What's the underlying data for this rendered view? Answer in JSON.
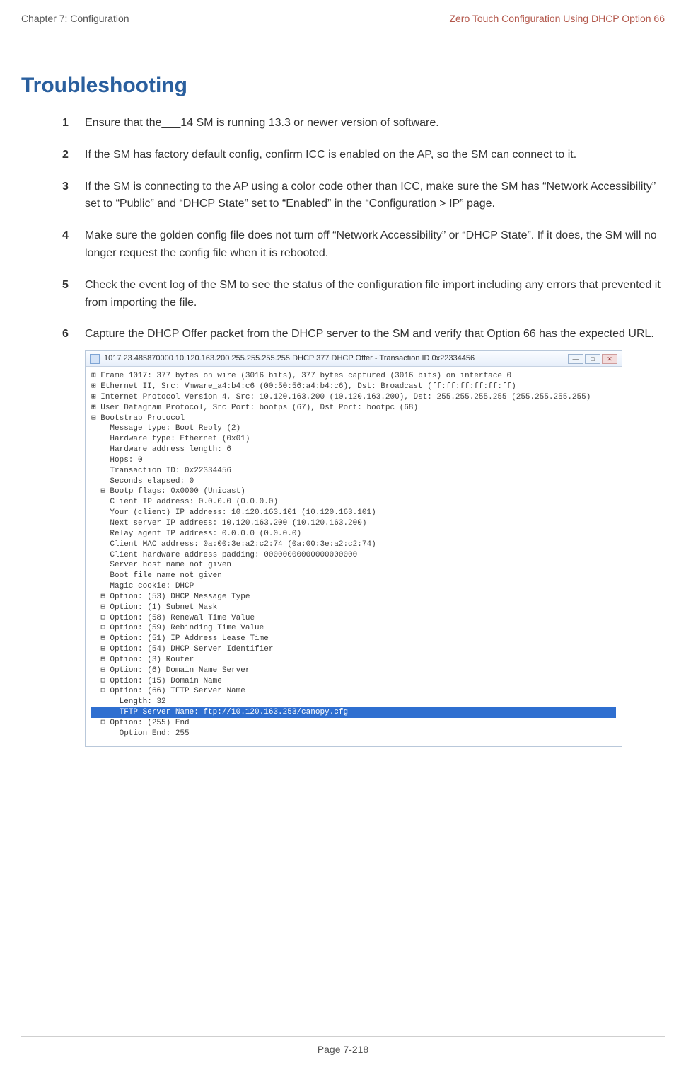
{
  "header": {
    "left": "Chapter 7:  Configuration",
    "right": "Zero Touch Configuration Using DHCP Option 66"
  },
  "title": "Troubleshooting",
  "steps": [
    {
      "n": "1",
      "t": "Ensure that the___14 SM is running 13.3 or newer version of software."
    },
    {
      "n": "2",
      "t": "If the SM has factory default config, confirm ICC is enabled on the AP, so the SM can connect to it."
    },
    {
      "n": "3",
      "t": "If the SM is connecting to the AP using a color code other than ICC, make sure the SM has “Network Accessibility” set to “Public” and “DHCP State” set to “Enabled” in the “Configuration > IP” page."
    },
    {
      "n": "4",
      "t": "Make sure the golden config file does not turn off “Network Accessibility” or “DHCP State”. If it does, the SM will no longer request the config file when it is rebooted."
    },
    {
      "n": "5",
      "t": "Check the event log of the SM to see the status of the configuration file import including any errors that prevented it from importing the file."
    },
    {
      "n": "6",
      "t": "Capture the DHCP Offer packet from the DHCP server to the SM and verify that Option 66 has the expected URL."
    }
  ],
  "figure": {
    "window_title": "1017 23.485870000 10.120.163.200 255.255.255.255 DHCP 377 DHCP Offer   - Transaction ID 0x22334456",
    "win_min": "—",
    "win_max": "□",
    "win_close": "✕",
    "lines": [
      "⊞ Frame 1017: 377 bytes on wire (3016 bits), 377 bytes captured (3016 bits) on interface 0",
      "⊞ Ethernet II, Src: Vmware_a4:b4:c6 (00:50:56:a4:b4:c6), Dst: Broadcast (ff:ff:ff:ff:ff:ff)",
      "⊞ Internet Protocol Version 4, Src: 10.120.163.200 (10.120.163.200), Dst: 255.255.255.255 (255.255.255.255)",
      "⊞ User Datagram Protocol, Src Port: bootps (67), Dst Port: bootpc (68)",
      "⊟ Bootstrap Protocol",
      "    Message type: Boot Reply (2)",
      "    Hardware type: Ethernet (0x01)",
      "    Hardware address length: 6",
      "    Hops: 0",
      "    Transaction ID: 0x22334456",
      "    Seconds elapsed: 0",
      "  ⊞ Bootp flags: 0x0000 (Unicast)",
      "    Client IP address: 0.0.0.0 (0.0.0.0)",
      "    Your (client) IP address: 10.120.163.101 (10.120.163.101)",
      "    Next server IP address: 10.120.163.200 (10.120.163.200)",
      "    Relay agent IP address: 0.0.0.0 (0.0.0.0)",
      "    Client MAC address: 0a:00:3e:a2:c2:74 (0a:00:3e:a2:c2:74)",
      "    Client hardware address padding: 00000000000000000000",
      "    Server host name not given",
      "    Boot file name not given",
      "    Magic cookie: DHCP",
      "  ⊞ Option: (53) DHCP Message Type",
      "  ⊞ Option: (1) Subnet Mask",
      "  ⊞ Option: (58) Renewal Time Value",
      "  ⊞ Option: (59) Rebinding Time Value",
      "  ⊞ Option: (51) IP Address Lease Time",
      "  ⊞ Option: (54) DHCP Server Identifier",
      "  ⊞ Option: (3) Router",
      "  ⊞ Option: (6) Domain Name Server",
      "  ⊞ Option: (15) Domain Name",
      "  ⊟ Option: (66) TFTP Server Name",
      "      Length: 32"
    ],
    "highlight": "      TFTP Server Name: ftp://10.120.163.253/canopy.cfg",
    "after": [
      "  ⊟ Option: (255) End",
      "      Option End: 255"
    ]
  },
  "footer": "Page 7-218"
}
